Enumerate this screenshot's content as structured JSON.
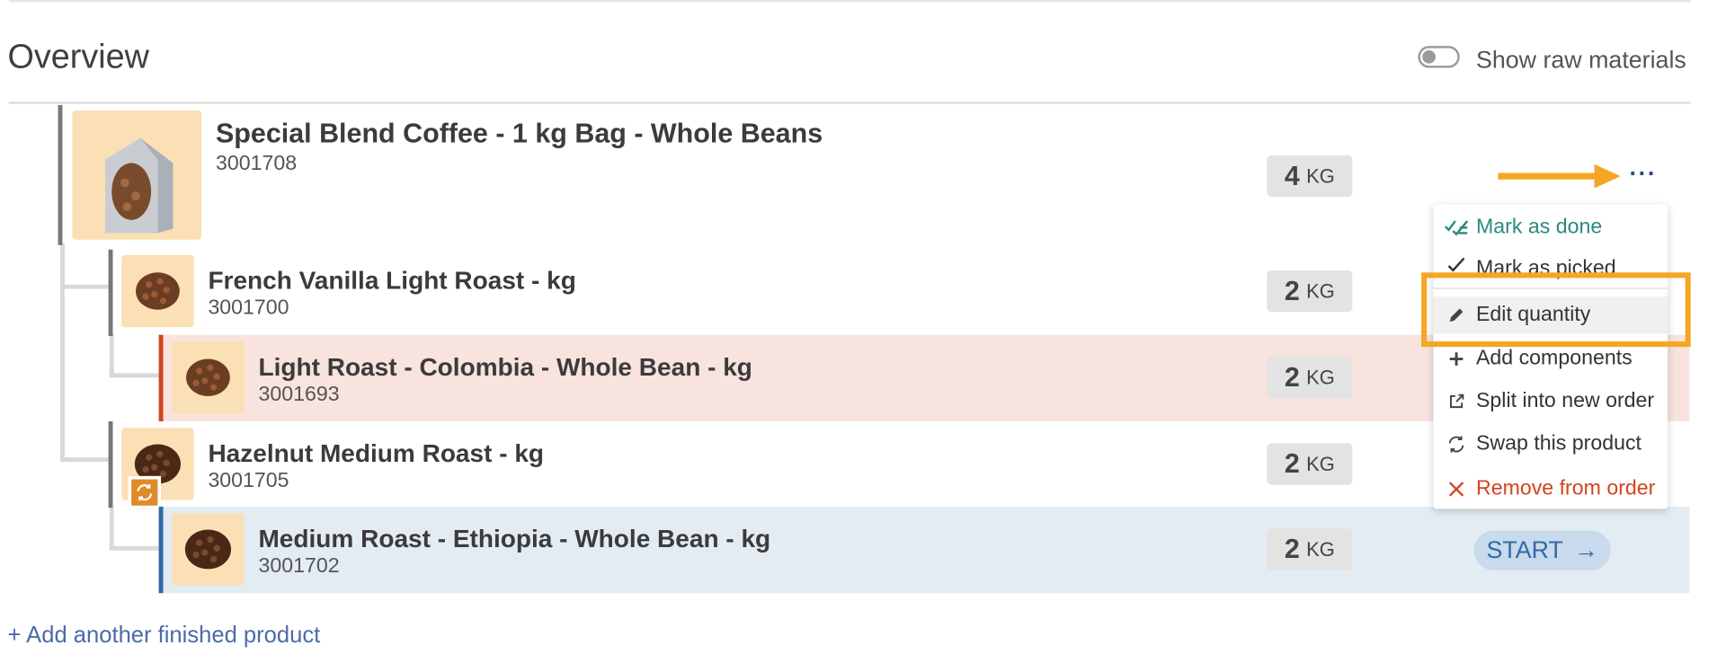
{
  "header": {
    "title": "Overview",
    "raw_toggle_label": "Show raw materials"
  },
  "products": [
    {
      "name": "Special Blend Coffee - 1 kg Bag - Whole Beans",
      "sku": "3001708",
      "qty": "4",
      "unit": "KG"
    },
    {
      "name": "French Vanilla Light Roast - kg",
      "sku": "3001700",
      "qty": "2",
      "unit": "KG"
    },
    {
      "name": "Light Roast - Colombia - Whole Bean - kg",
      "sku": "3001693",
      "qty": "2",
      "unit": "KG"
    },
    {
      "name": "Hazelnut Medium Roast - kg",
      "sku": "3001705",
      "qty": "2",
      "unit": "KG"
    },
    {
      "name": "Medium Roast - Ethiopia - Whole Bean - kg",
      "sku": "3001702",
      "qty": "2",
      "unit": "KG"
    }
  ],
  "menu": {
    "items": [
      {
        "label": "Mark as done",
        "icon": "check-list-icon"
      },
      {
        "label": "Mark as picked",
        "icon": "check-icon"
      },
      {
        "label": "Edit quantity",
        "icon": "pencil-icon"
      },
      {
        "label": "Add components",
        "icon": "plus-icon"
      },
      {
        "label": "Split into new order",
        "icon": "external-link-icon"
      },
      {
        "label": "Swap this product",
        "icon": "swap-icon"
      },
      {
        "label": "Remove from order",
        "icon": "close-icon"
      }
    ]
  },
  "start_button": {
    "label": "START",
    "icon": "arrow-right-icon"
  },
  "add_link": "+ Add another finished product",
  "colors": {
    "accent_orange": "#f5a623",
    "done_teal": "#2a8a7e",
    "danger_red": "#d2441f",
    "link_blue": "#4d6aa8"
  }
}
